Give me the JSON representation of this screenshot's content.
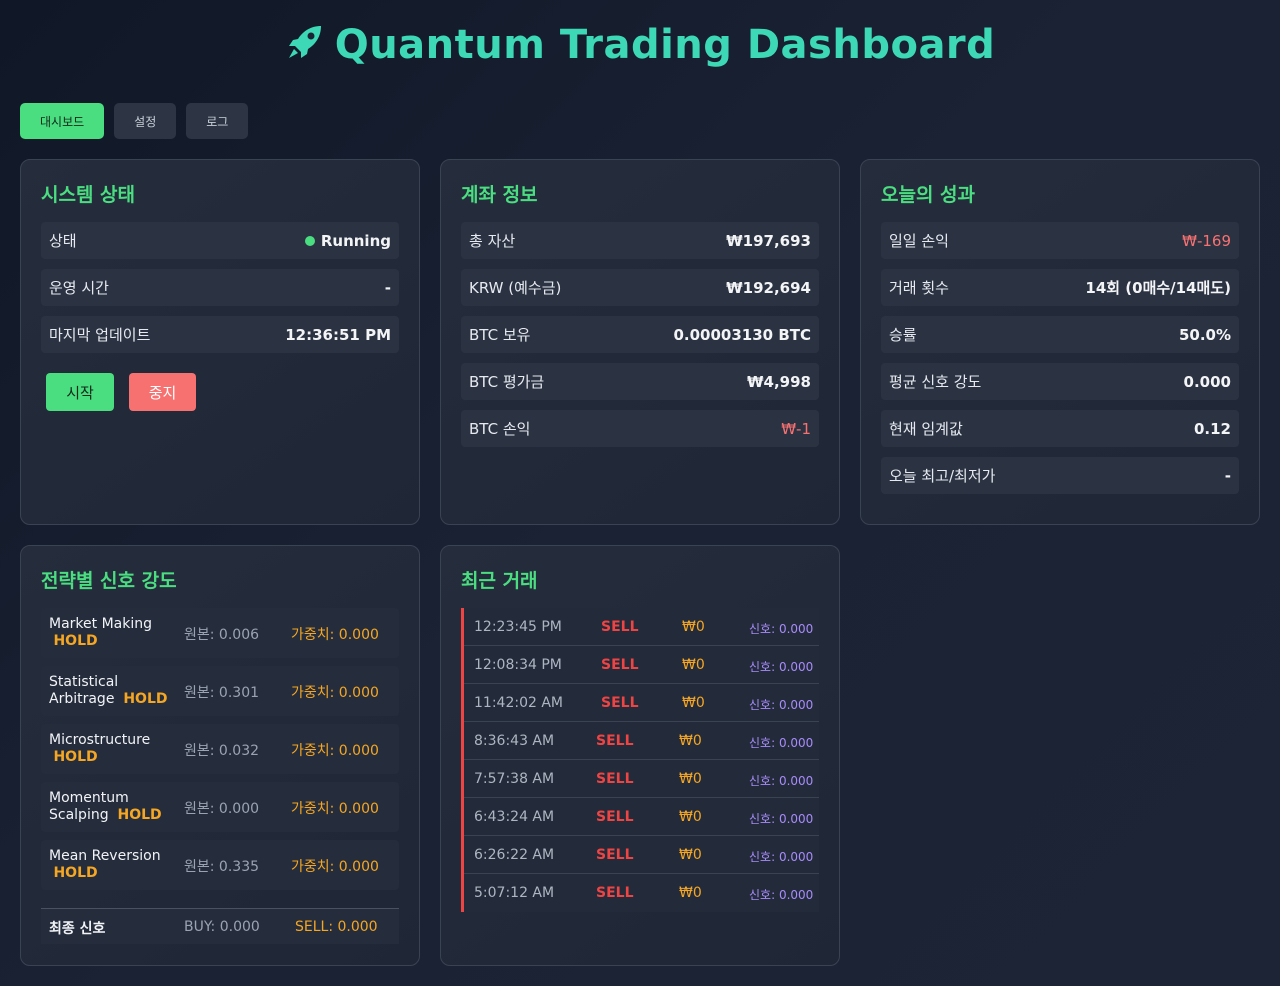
{
  "header": {
    "title": "Quantum Trading Dashboard",
    "icon": "rocket-icon",
    "accent": "#3dd9b6"
  },
  "nav": [
    {
      "label": "대시보드",
      "active": true
    },
    {
      "label": "설정",
      "active": false
    },
    {
      "label": "로그",
      "active": false
    }
  ],
  "system": {
    "title": "시스템 상태",
    "rows": [
      {
        "label": "상태",
        "value": "Running"
      },
      {
        "label": "운영 시간",
        "value": "-"
      },
      {
        "label": "마지막 업데이트",
        "value": "12:36:51 PM"
      }
    ],
    "start_label": "시작",
    "stop_label": "중지"
  },
  "account": {
    "title": "계좌 정보",
    "rows": [
      {
        "label": "총 자산",
        "value": "₩197,693"
      },
      {
        "label": "KRW (예수금)",
        "value": "₩192,694"
      },
      {
        "label": "BTC 보유",
        "value": "0.00003130 BTC"
      },
      {
        "label": "BTC 평가금",
        "value": "₩4,998"
      },
      {
        "label": "BTC 손익",
        "value": "₩-1"
      }
    ]
  },
  "performance": {
    "title": "오늘의 성과",
    "rows": [
      {
        "label": "일일 손익",
        "value": "₩-169"
      },
      {
        "label": "거래 횟수",
        "value": "14회 (0매수/14매도)"
      },
      {
        "label": "승률",
        "value": "50.0%"
      },
      {
        "label": "평균 신호 강도",
        "value": "0.000"
      },
      {
        "label": "현재 임계값",
        "value": "0.12"
      },
      {
        "label": "오늘 최고/최저가",
        "value": "-"
      }
    ]
  },
  "strategies": {
    "title": "전략별 신호 강도",
    "items": [
      {
        "name": "Market Making",
        "signal": "HOLD",
        "raw": "원본: 0.006",
        "weighted": "가중치: 0.000"
      },
      {
        "name": "Statistical Arbitrage",
        "signal": "HOLD",
        "raw": "원본: 0.301",
        "weighted": "가중치: 0.000"
      },
      {
        "name": "Microstructure",
        "signal": "HOLD",
        "raw": "원본: 0.032",
        "weighted": "가중치: 0.000"
      },
      {
        "name": "Momentum Scalping",
        "signal": "HOLD",
        "raw": "원본: 0.000",
        "weighted": "가중치: 0.000"
      },
      {
        "name": "Mean Reversion",
        "signal": "HOLD",
        "raw": "원본: 0.335",
        "weighted": "가중치: 0.000"
      }
    ],
    "final_label": "최종 신호",
    "final_buy": "BUY: 0.000",
    "final_sell": "SELL: 0.000"
  },
  "trades": {
    "title": "최근 거래",
    "items": [
      {
        "time": "12:23:45 PM",
        "side": "SELL",
        "amount": "₩0",
        "signal": "신호: 0.000"
      },
      {
        "time": "12:08:34 PM",
        "side": "SELL",
        "amount": "₩0",
        "signal": "신호: 0.000"
      },
      {
        "time": "11:42:02 AM",
        "side": "SELL",
        "amount": "₩0",
        "signal": "신호: 0.000"
      },
      {
        "time": "8:36:43 AM",
        "side": "SELL",
        "amount": "₩0",
        "signal": "신호: 0.000"
      },
      {
        "time": "7:57:38 AM",
        "side": "SELL",
        "amount": "₩0",
        "signal": "신호: 0.000"
      },
      {
        "time": "6:43:24 AM",
        "side": "SELL",
        "amount": "₩0",
        "signal": "신호: 0.000"
      },
      {
        "time": "6:26:22 AM",
        "side": "SELL",
        "amount": "₩0",
        "signal": "신호: 0.000"
      },
      {
        "time": "5:07:12 AM",
        "side": "SELL",
        "amount": "₩0",
        "signal": "신호: 0.000"
      }
    ]
  },
  "colors": {
    "positive": "#4ade80",
    "negative": "#f87171",
    "hold": "#f5a623",
    "signal": "#a78bfa"
  }
}
